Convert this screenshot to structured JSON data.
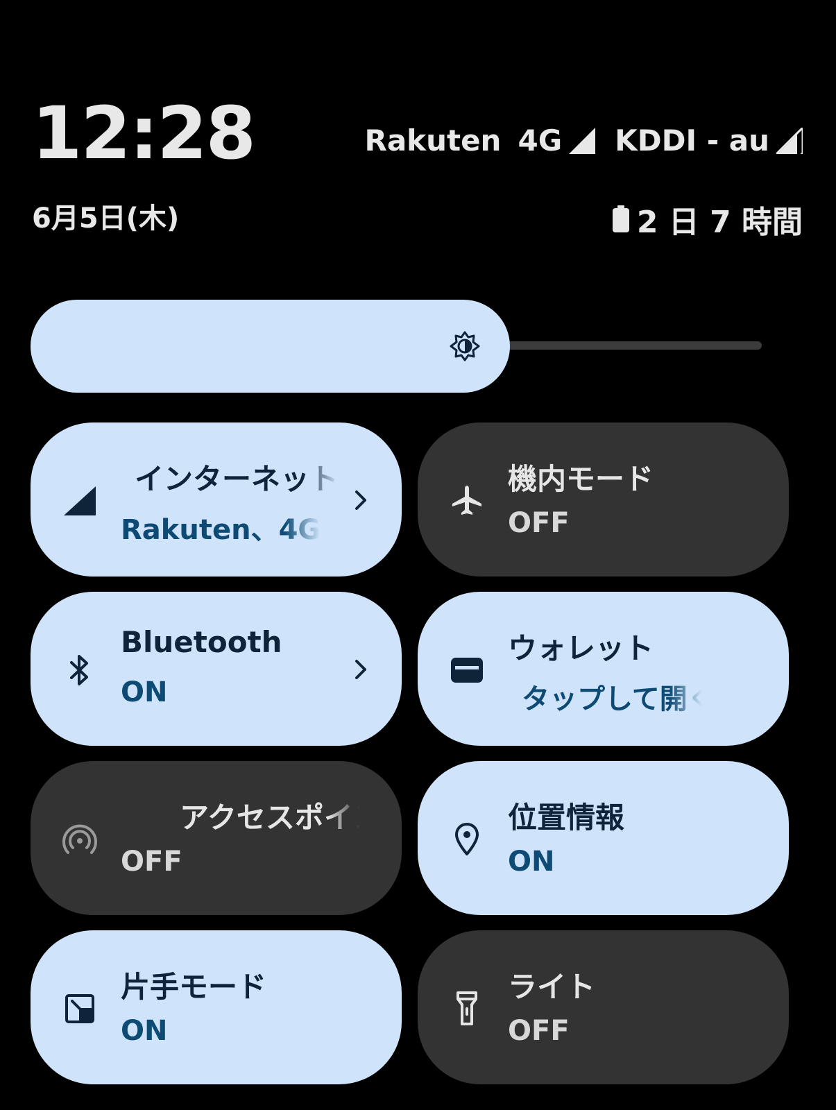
{
  "status": {
    "time": "12:28",
    "date": "6月5日(木)",
    "carrier1": "Rakuten",
    "carrier1_network": "4G",
    "carrier2": "KDDI - au",
    "battery_text": "2 日 7 時間"
  },
  "brightness": {
    "level": 0.58,
    "icon": "brightness-icon"
  },
  "tiles": [
    {
      "title": "インターネット",
      "sub": "Rakuten、4G",
      "state": "on",
      "icon": "signal-icon",
      "chevron": true
    },
    {
      "title": "機内モード",
      "sub": "OFF",
      "state": "off",
      "icon": "airplane-icon",
      "chevron": false
    },
    {
      "title": "Bluetooth",
      "sub": "ON",
      "state": "on",
      "icon": "bluetooth-icon",
      "chevron": true
    },
    {
      "title": "ウォレット",
      "sub": "タップして開く",
      "state": "on",
      "icon": "wallet-icon",
      "chevron": false
    },
    {
      "title": "アクセスポイント",
      "sub": "OFF",
      "state": "off",
      "icon": "hotspot-icon",
      "chevron": false
    },
    {
      "title": "位置情報",
      "sub": "ON",
      "state": "on",
      "icon": "location-icon",
      "chevron": false
    },
    {
      "title": "片手モード",
      "sub": "ON",
      "state": "on",
      "icon": "one-handed-icon",
      "chevron": false
    },
    {
      "title": "ライト",
      "sub": "OFF",
      "state": "off",
      "icon": "flashlight-icon",
      "chevron": false
    }
  ],
  "colors": {
    "background": "#000000",
    "tile_on": "#cfe4fb",
    "tile_off": "#333333",
    "text_on": "#0f2438",
    "sub_on": "#0d4a74"
  }
}
